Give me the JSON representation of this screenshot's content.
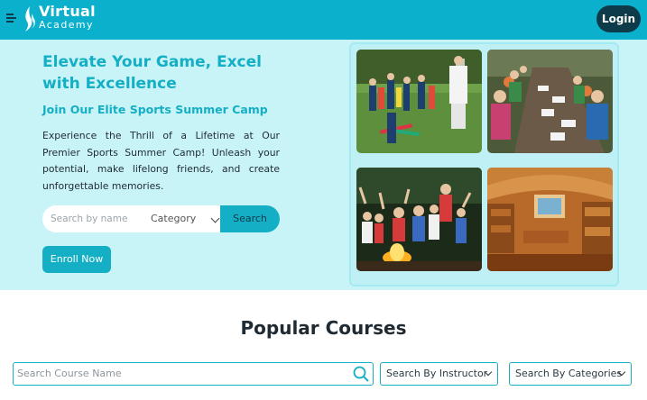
{
  "header": {
    "logo_line1": "Virtual",
    "logo_line2": "Academy",
    "login_label": "Login"
  },
  "hero": {
    "title": "Elevate Your Game, Excel with Excellence",
    "subtitle": "Join Our Elite Sports Summer Camp",
    "paragraph": "Experience the Thrill of a Lifetime at Our Premier Sports Summer Camp! Unleash your potential, make lifelong friends, and create unforgettable memories.",
    "search_placeholder": "Search by name",
    "category_selected": "Category",
    "search_button": "Search",
    "enroll_button": "Enroll Now"
  },
  "courses": {
    "title": "Popular Courses",
    "search_placeholder": "Search Course Name",
    "instructor_filter": "Search By Instructor",
    "category_filter": "Search By Categories"
  },
  "colors": {
    "brand": "#0ab0cc",
    "accent": "#14afc4",
    "dark": "#0d3b4a",
    "hero_bg": "#c8f4f8"
  }
}
